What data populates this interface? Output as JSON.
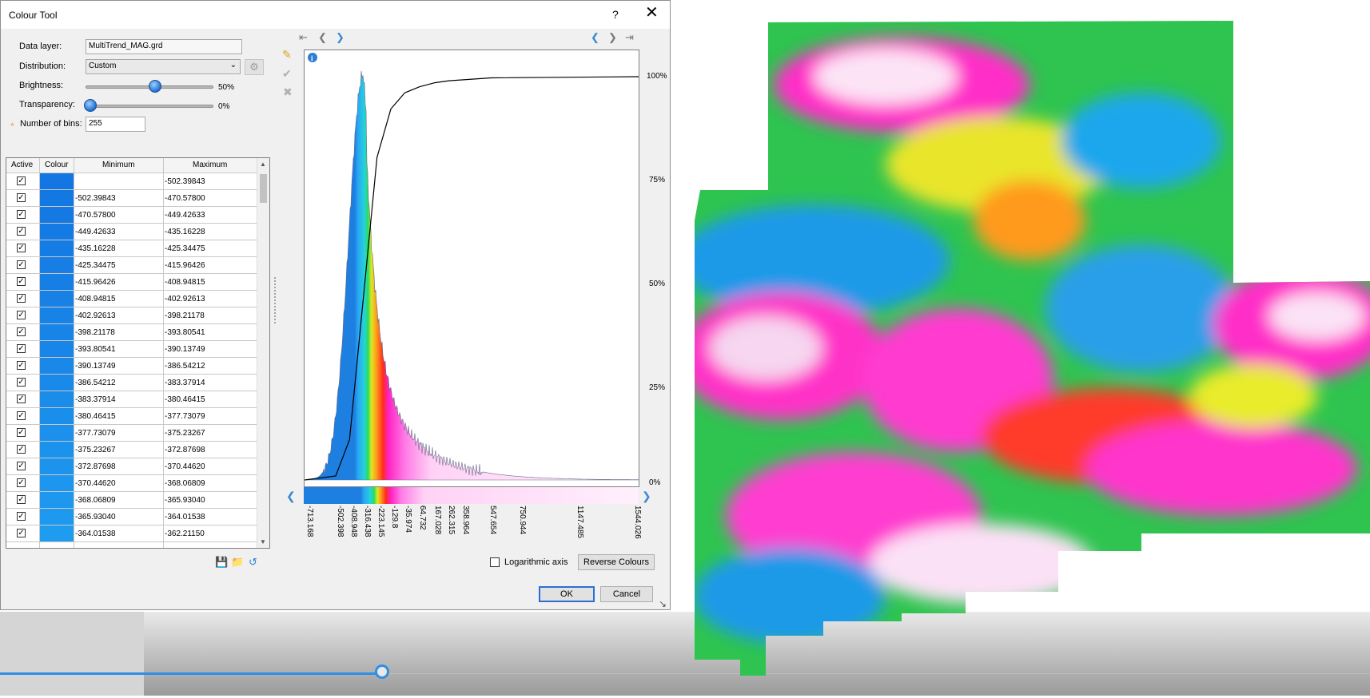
{
  "dialog": {
    "title": "Colour Tool",
    "help": "?",
    "close": "✕",
    "data_layer_label": "Data layer:",
    "data_layer_value": "MultiTrend_MAG.grd",
    "distribution_label": "Distribution:",
    "distribution_value": "Custom",
    "brightness_label": "Brightness:",
    "brightness_value": "50%",
    "brightness_level": 0.5,
    "transparency_label": "Transparency:",
    "transparency_value": "0%",
    "transparency_level": 0,
    "bins_label": "Number of bins:",
    "bins_value": "255",
    "required_mark": "*"
  },
  "table": {
    "headers": [
      "Active",
      "Colour",
      "Minimum",
      "Maximum"
    ],
    "rows": [
      {
        "min": "",
        "max": "-502.39843",
        "color": "#1476e2"
      },
      {
        "min": "-502.39843",
        "max": "-470.57800",
        "color": "#1478e3"
      },
      {
        "min": "-470.57800",
        "max": "-449.42633",
        "color": "#1479e3"
      },
      {
        "min": "-449.42633",
        "max": "-435.16228",
        "color": "#157be4"
      },
      {
        "min": "-435.16228",
        "max": "-425.34475",
        "color": "#157ce4"
      },
      {
        "min": "-425.34475",
        "max": "-415.96426",
        "color": "#167ee5"
      },
      {
        "min": "-415.96426",
        "max": "-408.94815",
        "color": "#167fe6"
      },
      {
        "min": "-408.94815",
        "max": "-402.92613",
        "color": "#1781e6"
      },
      {
        "min": "-402.92613",
        "max": "-398.21178",
        "color": "#1783e7"
      },
      {
        "min": "-398.21178",
        "max": "-393.80541",
        "color": "#1884e8"
      },
      {
        "min": "-393.80541",
        "max": "-390.13749",
        "color": "#1886e8"
      },
      {
        "min": "-390.13749",
        "max": "-386.54212",
        "color": "#1988e9"
      },
      {
        "min": "-386.54212",
        "max": "-383.37914",
        "color": "#198aea"
      },
      {
        "min": "-383.37914",
        "max": "-380.46415",
        "color": "#1a8cea"
      },
      {
        "min": "-380.46415",
        "max": "-377.73079",
        "color": "#1a8eeb"
      },
      {
        "min": "-377.73079",
        "max": "-375.23267",
        "color": "#1b90ec"
      },
      {
        "min": "-375.23267",
        "max": "-372.87698",
        "color": "#1b92ec"
      },
      {
        "min": "-372.87698",
        "max": "-370.44620",
        "color": "#1c94ed"
      },
      {
        "min": "-370.44620",
        "max": "-368.06809",
        "color": "#1c96ee"
      },
      {
        "min": "-368.06809",
        "max": "-365.93040",
        "color": "#1d98ee"
      },
      {
        "min": "-365.93040",
        "max": "-364.01538",
        "color": "#1d9aef"
      },
      {
        "min": "-364.01538",
        "max": "-362.21150",
        "color": "#1e9cf0"
      }
    ]
  },
  "chart_data": {
    "type": "area",
    "subtype": "histogram with cumulative curve",
    "x_ticks": [
      "-713.168",
      "-502.398",
      "-408.948",
      "-316.438",
      "-223.145",
      "-129.8",
      "-35.974",
      "64.732",
      "167.028",
      "262.315",
      "358.964",
      "547.654",
      "750.944",
      "1147.485",
      "1544.026"
    ],
    "xlim": [
      -713.168,
      1544.026
    ],
    "y_right_ticks": [
      "100%",
      "75%",
      "50%",
      "25%",
      "0%"
    ],
    "histogram_peak_x": -316.438,
    "cumulative_curve": [
      {
        "x": -713.168,
        "y": 0
      },
      {
        "x": -502.398,
        "y": 0.01
      },
      {
        "x": -408.948,
        "y": 0.1
      },
      {
        "x": -316.438,
        "y": 0.45
      },
      {
        "x": -223.145,
        "y": 0.8
      },
      {
        "x": -129.8,
        "y": 0.92
      },
      {
        "x": -35.974,
        "y": 0.96
      },
      {
        "x": 64.732,
        "y": 0.975
      },
      {
        "x": 167.028,
        "y": 0.985
      },
      {
        "x": 262.315,
        "y": 0.99
      },
      {
        "x": 547.654,
        "y": 0.997
      },
      {
        "x": 1544.026,
        "y": 1.0
      }
    ],
    "colors": {
      "low": "#1d7fe0",
      "mid": "#2bdc5a",
      "high": "#ff21c2",
      "curve": "#000000"
    }
  },
  "footer": {
    "log_axis_label": "Logarithmic axis",
    "reverse_label": "Reverse Colours",
    "ok_label": "OK",
    "cancel_label": "Cancel"
  },
  "icons": {
    "edit": "pencil-icon",
    "apply": "check-icon",
    "delete": "cross-icon",
    "save": "save-icon",
    "open": "folder-icon",
    "reset": "reset-icon",
    "info": "info-icon",
    "settings": "gear-icon"
  }
}
